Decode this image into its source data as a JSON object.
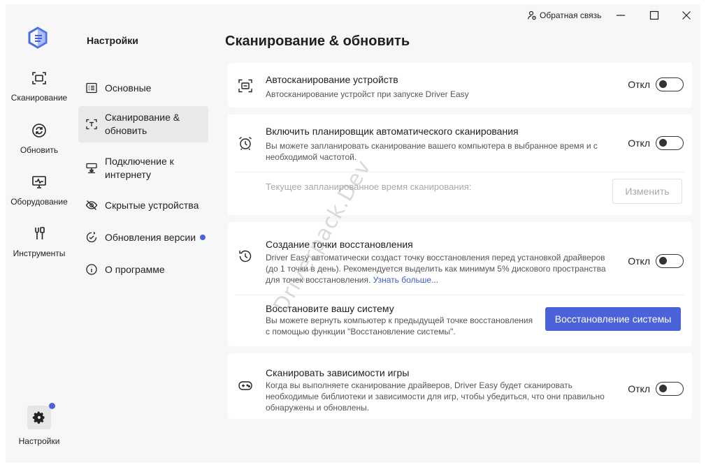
{
  "window": {
    "feedback_label": "Обратная связь"
  },
  "rail": {
    "items": [
      {
        "label": "Сканирование",
        "icon": "scan-icon"
      },
      {
        "label": "Обновить",
        "icon": "refresh-icon"
      },
      {
        "label": "Оборудование",
        "icon": "monitor-icon"
      },
      {
        "label": "Инструменты",
        "icon": "tools-icon"
      }
    ],
    "settings_label": "Настройки"
  },
  "nav": {
    "title": "Настройки",
    "items": [
      {
        "label": "Основные",
        "icon": "list-icon"
      },
      {
        "label": "Сканирование & обновить",
        "line1": "Сканирование &",
        "line2": "обновить",
        "icon": "scan-text-icon"
      },
      {
        "label": "Подключение к интернету",
        "line1": "Подключение к",
        "line2": "интернету",
        "icon": "network-icon"
      },
      {
        "label": "Скрытые устройства",
        "icon": "eye-off-icon"
      },
      {
        "label": "Обновления версии",
        "icon": "update-check-icon"
      },
      {
        "label": "О программе",
        "icon": "info-icon"
      }
    ]
  },
  "main": {
    "title": "Сканирование & обновить",
    "toggle_off_label": "Откл",
    "auto_scan": {
      "title": "Автосканирование устройств",
      "desc": "Автосканирование устройст при запуске Driver Easy"
    },
    "scheduler": {
      "title": "Включить планировщик автоматического сканирования",
      "desc_line1": "Вы можете запланировать сканирование вашего компьютера в выбранное время и с",
      "desc_line2": "необходимой частотой.",
      "current_label": "Текущее запланированное время сканирования:",
      "change_button": "Изменить"
    },
    "restore_point": {
      "title": "Создание точки восстановления",
      "desc_line1": "Driver Easy автоматически создаст точку восстановления перед установкой драйверов",
      "desc_line2": "(до 1 точки в день). Рекомендуется выделить как минимум 5% дискового пространства",
      "desc_line3": "для точек восстановления.",
      "learn_more": "Узнать больше..."
    },
    "restore_system": {
      "title": "Восстановите вашу систему",
      "desc_line1": "Вы можете вернуть компьютер к предыдущей точке восстановления",
      "desc_line2": "с помощью функции \"Восстановление системы\".",
      "button": "Восстановление системы"
    },
    "game_deps": {
      "title": "Сканировать зависимости игры",
      "desc_line1": "Когда вы выполняете сканирование драйверов, Driver Easy будет сканировать",
      "desc_line2": "необходимые библиотеки и зависимости для игр, чтобы убедиться, что они правильно",
      "desc_line3": "обнаружены и обновлены."
    },
    "watermark": "Driverpack.Dev"
  },
  "colors": {
    "accent": "#4a63d8",
    "background": "#f7f7f7",
    "card": "#ffffff"
  }
}
